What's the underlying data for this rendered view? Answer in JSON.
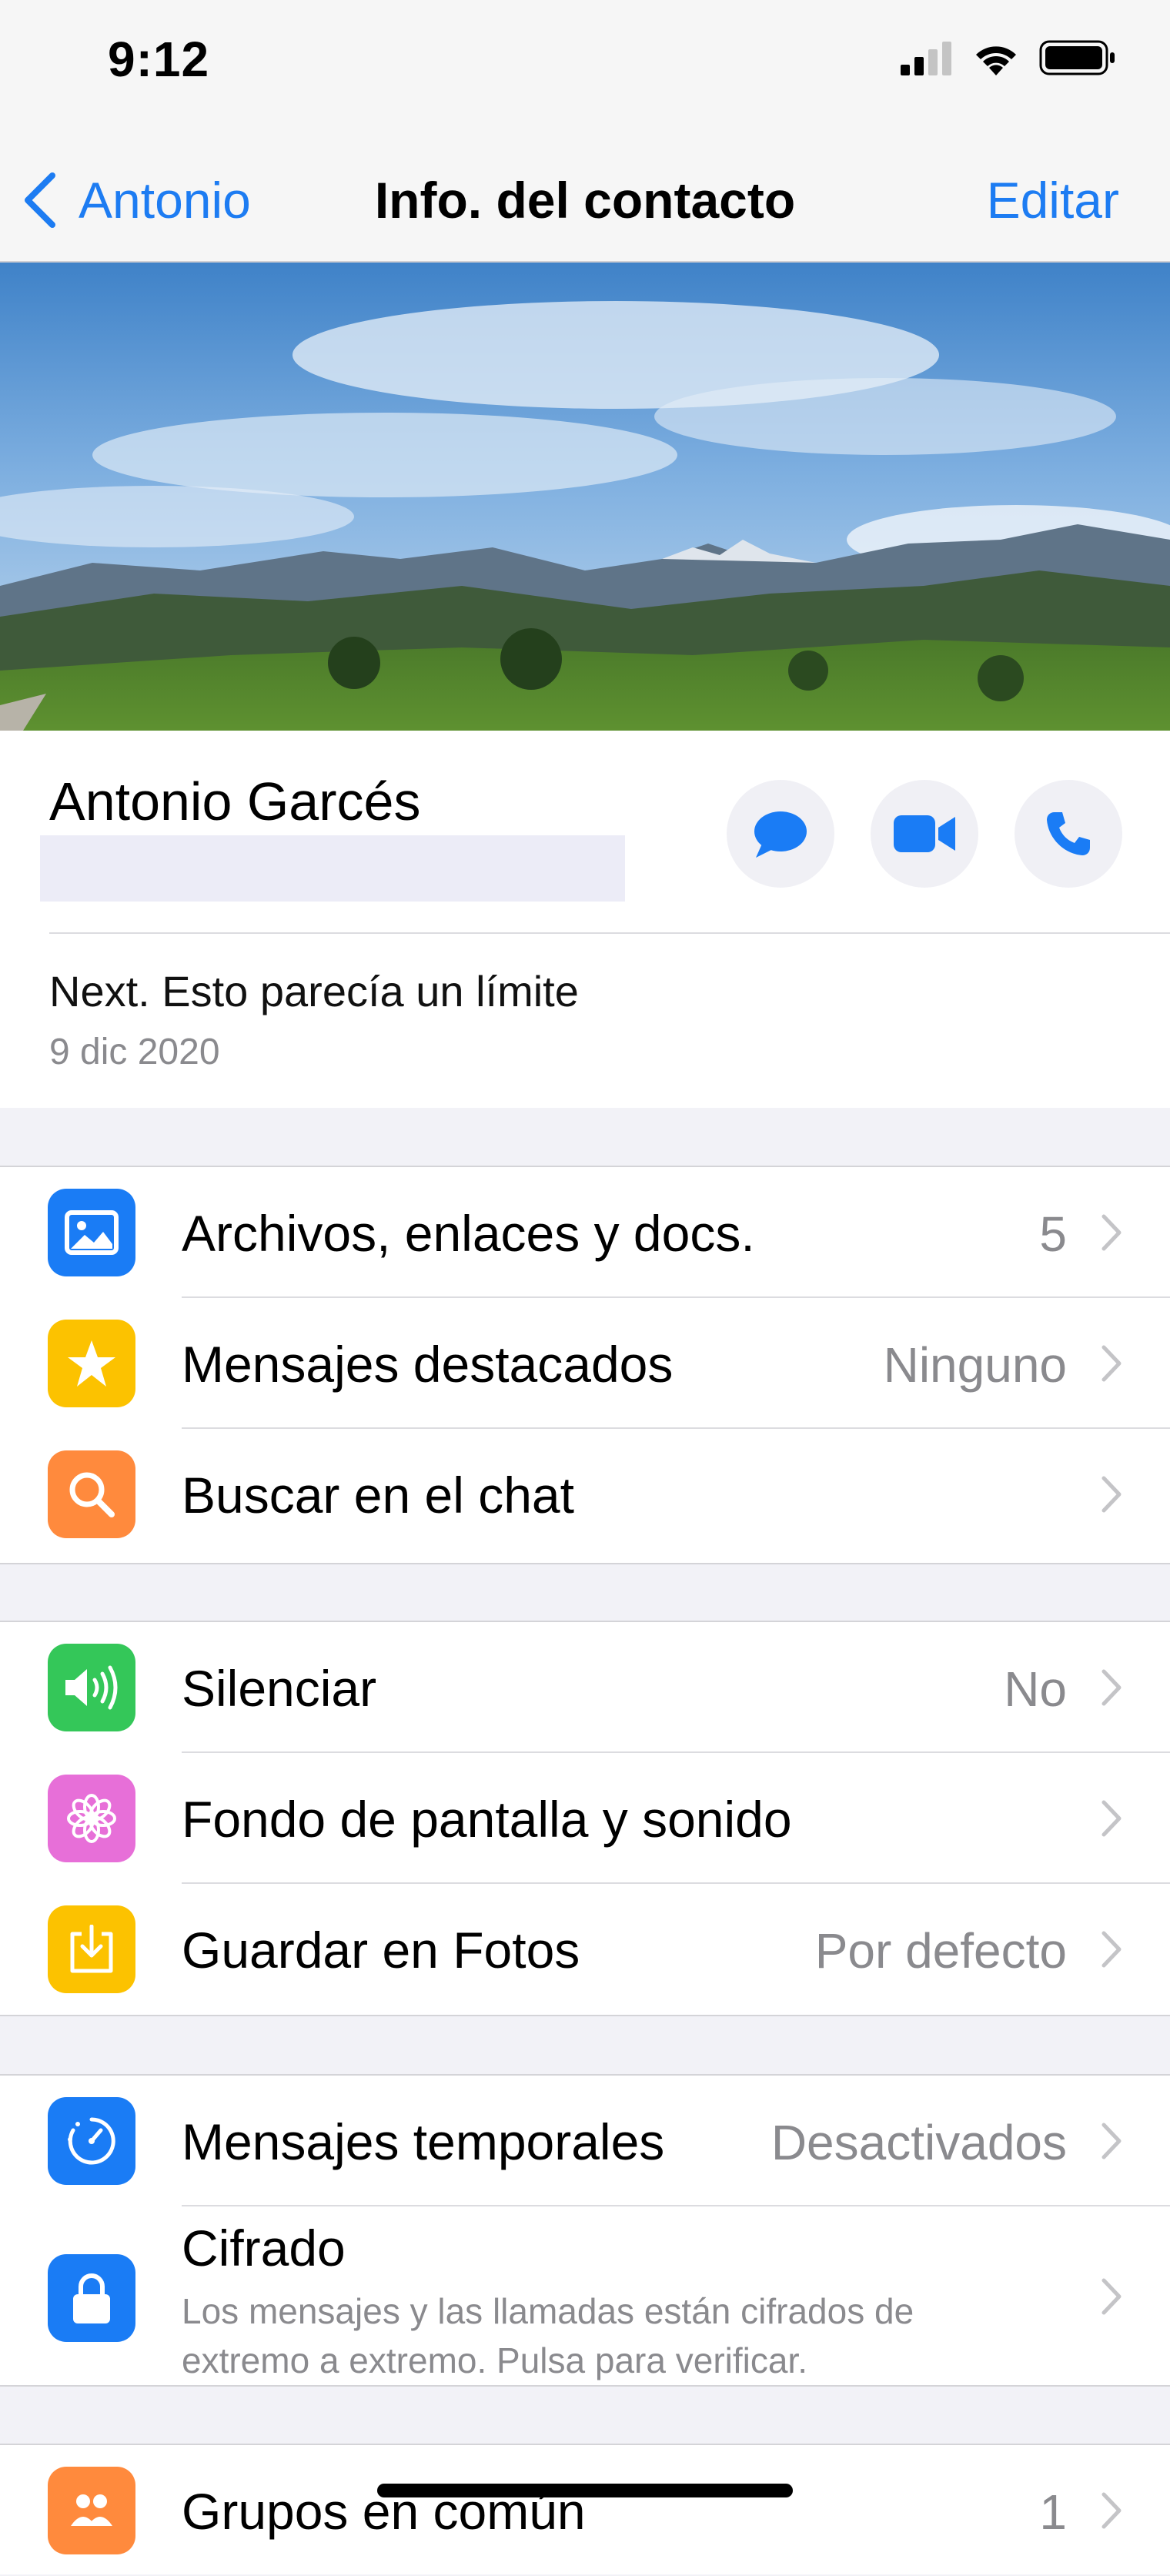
{
  "status_bar": {
    "time": "9:12"
  },
  "nav": {
    "back_label": "Antonio",
    "title": "Info. del contacto",
    "edit_label": "Editar"
  },
  "profile": {
    "name": "Antonio Garcés",
    "status": "Next. Esto parecía un límite",
    "status_date": "9 dic 2020"
  },
  "sections": {
    "media": {
      "files": {
        "label": "Archivos, enlaces y docs.",
        "value": "5",
        "icon": "photo-icon",
        "color": "#1a7cf5"
      },
      "starred": {
        "label": "Mensajes destacados",
        "value": "Ninguno",
        "icon": "star-icon",
        "color": "#fcc200"
      },
      "search": {
        "label": "Buscar en el chat",
        "icon": "search-icon",
        "color": "#ff8a3d"
      }
    },
    "settings": {
      "mute": {
        "label": "Silenciar",
        "value": "No",
        "icon": "speaker-icon",
        "color": "#34c759"
      },
      "wallpaper": {
        "label": "Fondo de pantalla y sonido",
        "icon": "flower-icon",
        "color": "#e76fd8"
      },
      "save_photos": {
        "label": "Guardar en Fotos",
        "value": "Por defecto",
        "icon": "download-icon",
        "color": "#fcc200"
      }
    },
    "privacy": {
      "temp_messages": {
        "label": "Mensajes temporales",
        "value": "Desactivados",
        "icon": "timer-icon",
        "color": "#1a7cf5"
      },
      "encryption": {
        "label": "Cifrado",
        "sub": "Los mensajes y las llamadas están cifrados de extremo a extremo. Pulsa para verificar.",
        "icon": "lock-icon",
        "color": "#1a7cf5"
      }
    },
    "groups": {
      "label": "Grupos en común",
      "value": "1",
      "icon": "group-icon",
      "color": "#ff8a3d"
    }
  }
}
